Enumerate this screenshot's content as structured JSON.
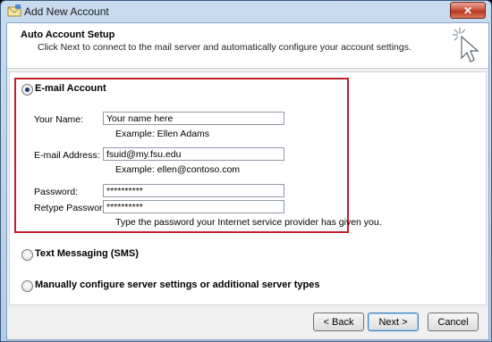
{
  "window": {
    "title": "Add New Account",
    "close_label": "✕"
  },
  "header": {
    "title": "Auto Account Setup",
    "subtitle": "Click Next to connect to the mail server and automatically configure your account settings."
  },
  "options": {
    "email_account": "E-mail Account",
    "text_messaging": "Text Messaging (SMS)",
    "manual": "Manually configure server settings or additional server types"
  },
  "form": {
    "name_label": "Your Name:",
    "name_value": "Your name here",
    "name_example": "Example: Ellen Adams",
    "email_label": "E-mail Address:",
    "email_value": "fsuid@my.fsu.edu",
    "email_example": "Example: ellen@contoso.com",
    "password_label": "Password:",
    "password_value": "**********",
    "retype_label": "Retype Password:",
    "retype_value": "**********",
    "password_hint": "Type the password your Internet service provider has given you."
  },
  "buttons": {
    "back": "< Back",
    "next": "Next >",
    "cancel": "Cancel"
  },
  "colors": {
    "highlight_border": "#c0202a",
    "close_button": "#c9503c"
  }
}
